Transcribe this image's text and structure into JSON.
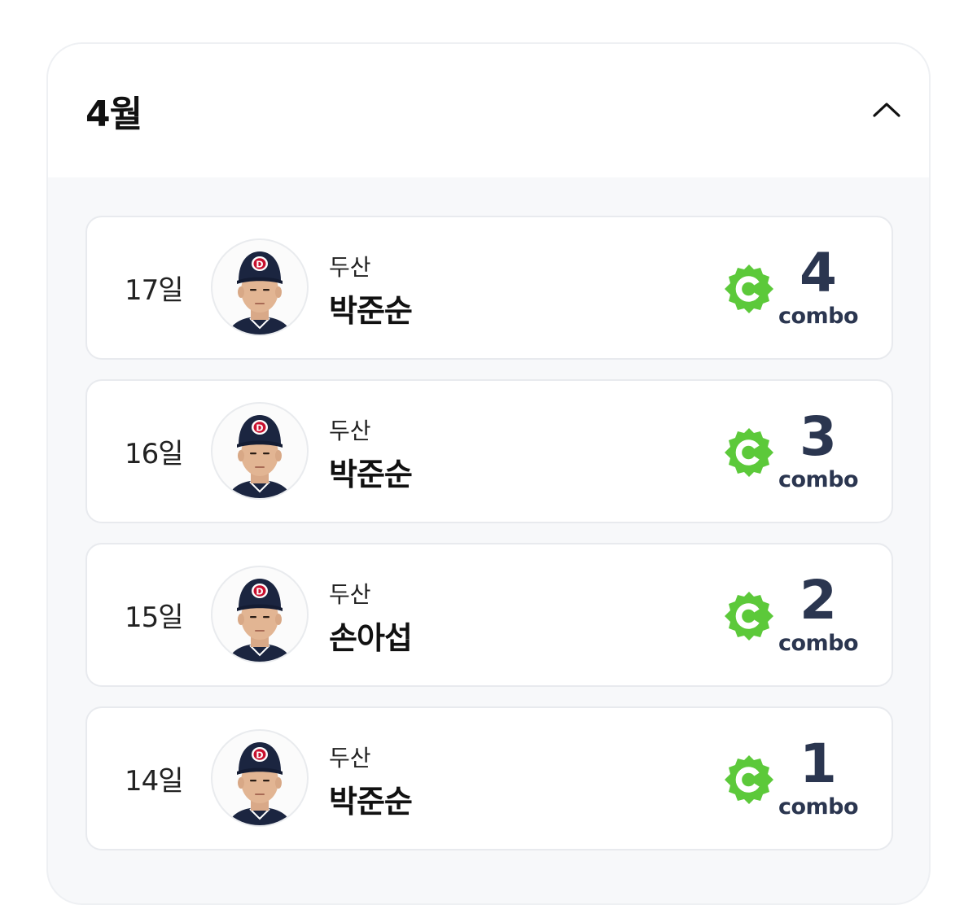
{
  "header": {
    "month": "4월",
    "collapse_icon": "chevron-up-icon"
  },
  "colors": {
    "badge_green": "#5cc93a",
    "count_navy": "#2b3650",
    "cap_navy": "#1b2540",
    "cap_logo_red": "#c8102e"
  },
  "entries": [
    {
      "day": "17일",
      "team": "두산",
      "player": "박준순",
      "count": "4",
      "unit": "combo"
    },
    {
      "day": "16일",
      "team": "두산",
      "player": "박준순",
      "count": "3",
      "unit": "combo"
    },
    {
      "day": "15일",
      "team": "두산",
      "player": "손아섭",
      "count": "2",
      "unit": "combo"
    },
    {
      "day": "14일",
      "team": "두산",
      "player": "박준순",
      "count": "1",
      "unit": "combo"
    }
  ]
}
